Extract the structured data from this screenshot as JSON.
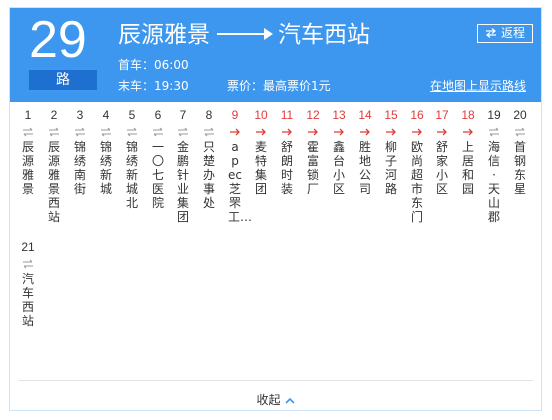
{
  "route": {
    "number": "29",
    "unit": "路",
    "from": "辰源雅景",
    "to": "汽车西站",
    "first_bus": "首车：06:00",
    "last_bus": "末车：19:30",
    "price": "票价：最高票价1元",
    "return_label": "返程",
    "map_link": "在地图上显示路线"
  },
  "stops": [
    {
      "num": "1",
      "name": "辰源雅景",
      "color": "gray"
    },
    {
      "num": "2",
      "name": "辰源雅景西站",
      "color": "gray"
    },
    {
      "num": "3",
      "name": "锦绣南街",
      "color": "gray"
    },
    {
      "num": "4",
      "name": "锦绣新城",
      "color": "gray"
    },
    {
      "num": "5",
      "name": "锦绣新城北",
      "color": "gray"
    },
    {
      "num": "6",
      "name": "一〇七医院",
      "color": "gray"
    },
    {
      "num": "7",
      "name": "金鹏针业集团",
      "color": "gray"
    },
    {
      "num": "8",
      "name": "只楚办事处",
      "color": "gray"
    },
    {
      "num": "9",
      "name": "apec芝罘工…",
      "color": "red"
    },
    {
      "num": "10",
      "name": "麦特集团",
      "color": "red"
    },
    {
      "num": "11",
      "name": "舒朗时装",
      "color": "red"
    },
    {
      "num": "12",
      "name": "霍富锁厂",
      "color": "red"
    },
    {
      "num": "13",
      "name": "鑫台小区",
      "color": "red"
    },
    {
      "num": "14",
      "name": "胜地公司",
      "color": "red"
    },
    {
      "num": "15",
      "name": "柳子河路",
      "color": "red"
    },
    {
      "num": "16",
      "name": "欧尚超市东门",
      "color": "red"
    },
    {
      "num": "17",
      "name": "舒家小区",
      "color": "red"
    },
    {
      "num": "18",
      "name": "上居和园",
      "color": "red"
    },
    {
      "num": "19",
      "name": "海信·天山郡",
      "color": "gray"
    },
    {
      "num": "20",
      "name": "首钢东星",
      "color": "gray"
    },
    {
      "num": "21",
      "name": "汽车西站",
      "color": "gray"
    }
  ],
  "footer": {
    "collapse_label": "收起"
  },
  "colors": {
    "header": "#3d97ef",
    "accent_red": "#e23b3b",
    "text": "#333333",
    "tag": "#1e6fcf"
  }
}
